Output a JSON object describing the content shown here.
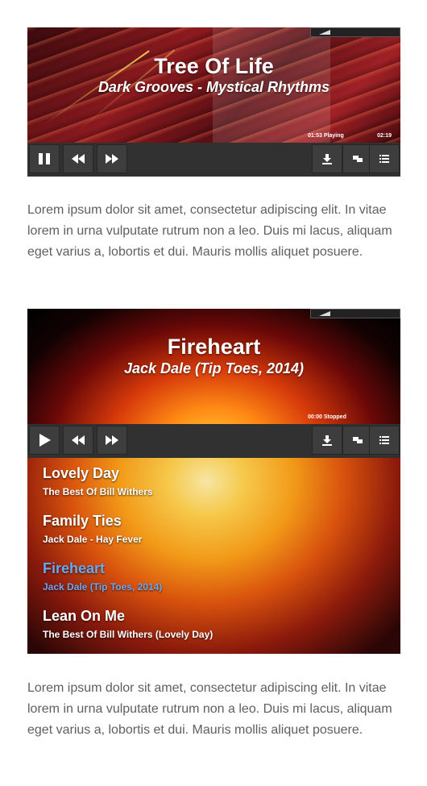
{
  "player1": {
    "title": "Tree Of Life",
    "subtitle": "Dark Grooves - Mystical Rhythms",
    "elapsed_status": "01:53 Playing",
    "duration": "02:19",
    "controls": {
      "play_state_icon": "pause-icon",
      "prev_icon": "rewind-icon",
      "next_icon": "fast-forward-icon",
      "download_icon": "download-icon",
      "popout_icon": "popout-icon",
      "playlist_icon": "playlist-icon"
    }
  },
  "paragraph1": "Lorem ipsum dolor sit amet, consectetur adipiscing elit. In vitae lorem in urna vulputate rutrum non a leo. Duis mi lacus, aliquam eget varius a, lobortis et dui. Mauris mollis aliquet posuere.",
  "player2": {
    "title": "Fireheart",
    "subtitle": "Jack Dale (Tip Toes, 2014)",
    "elapsed_status": "00:00 Stopped",
    "controls": {
      "play_state_icon": "play-icon",
      "prev_icon": "rewind-icon",
      "next_icon": "fast-forward-icon",
      "download_icon": "download-icon",
      "popout_icon": "popout-icon",
      "playlist_icon": "playlist-icon"
    },
    "playlist": [
      {
        "name": "Lovely Day",
        "sub": "The Best Of Bill Withers"
      },
      {
        "name": "Family Ties",
        "sub": "Jack Dale - Hay Fever"
      },
      {
        "name": "Fireheart",
        "sub": "Jack Dale (Tip Toes, 2014)",
        "active": true
      },
      {
        "name": "Lean On Me",
        "sub": "The Best Of Bill Withers (Lovely Day)"
      }
    ]
  },
  "paragraph2": "Lorem ipsum dolor sit amet, consectetur adipiscing elit. In vitae lorem in urna vulputate rutrum non a leo. Duis mi lacus, aliquam eget varius a, lobortis et dui. Mauris mollis aliquet posuere.",
  "colors": {
    "active_track": "#6aa8f0",
    "paragraph_text": "#5f5f5f",
    "control_bar": "#313131"
  }
}
